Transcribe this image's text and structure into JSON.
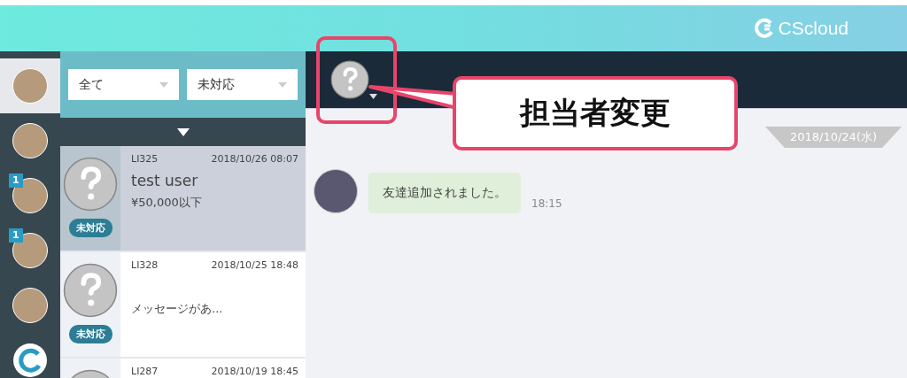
{
  "header": {
    "logo_text": "CScloud"
  },
  "rail": {
    "accounts": [
      {
        "kind": "photo",
        "selected": true
      },
      {
        "kind": "photo",
        "selected": false
      },
      {
        "kind": "photo",
        "selected": false,
        "badge": "1"
      },
      {
        "kind": "photo",
        "selected": false,
        "badge": "1"
      },
      {
        "kind": "photo",
        "selected": false
      },
      {
        "kind": "logo",
        "selected": false
      }
    ]
  },
  "filters": [
    {
      "value": "全て"
    },
    {
      "value": "未対応"
    }
  ],
  "conversations": [
    {
      "id": "LI325",
      "time": "2018/10/26 08:07",
      "name": "test user",
      "preview": "¥50,000以下",
      "status": "未対応",
      "selected": true
    },
    {
      "id": "LI328",
      "time": "2018/10/25 18:48",
      "preview": "メッセージがあ...",
      "status": "未対応",
      "selected": false
    },
    {
      "id": "LI287",
      "time": "2018/10/19 18:45",
      "selected": false
    }
  ],
  "chat": {
    "date": "2018/10/24(水)",
    "messages": [
      {
        "text": "友達追加されました。",
        "time": "18:15"
      }
    ]
  },
  "callout": {
    "text": "担当者変更"
  }
}
